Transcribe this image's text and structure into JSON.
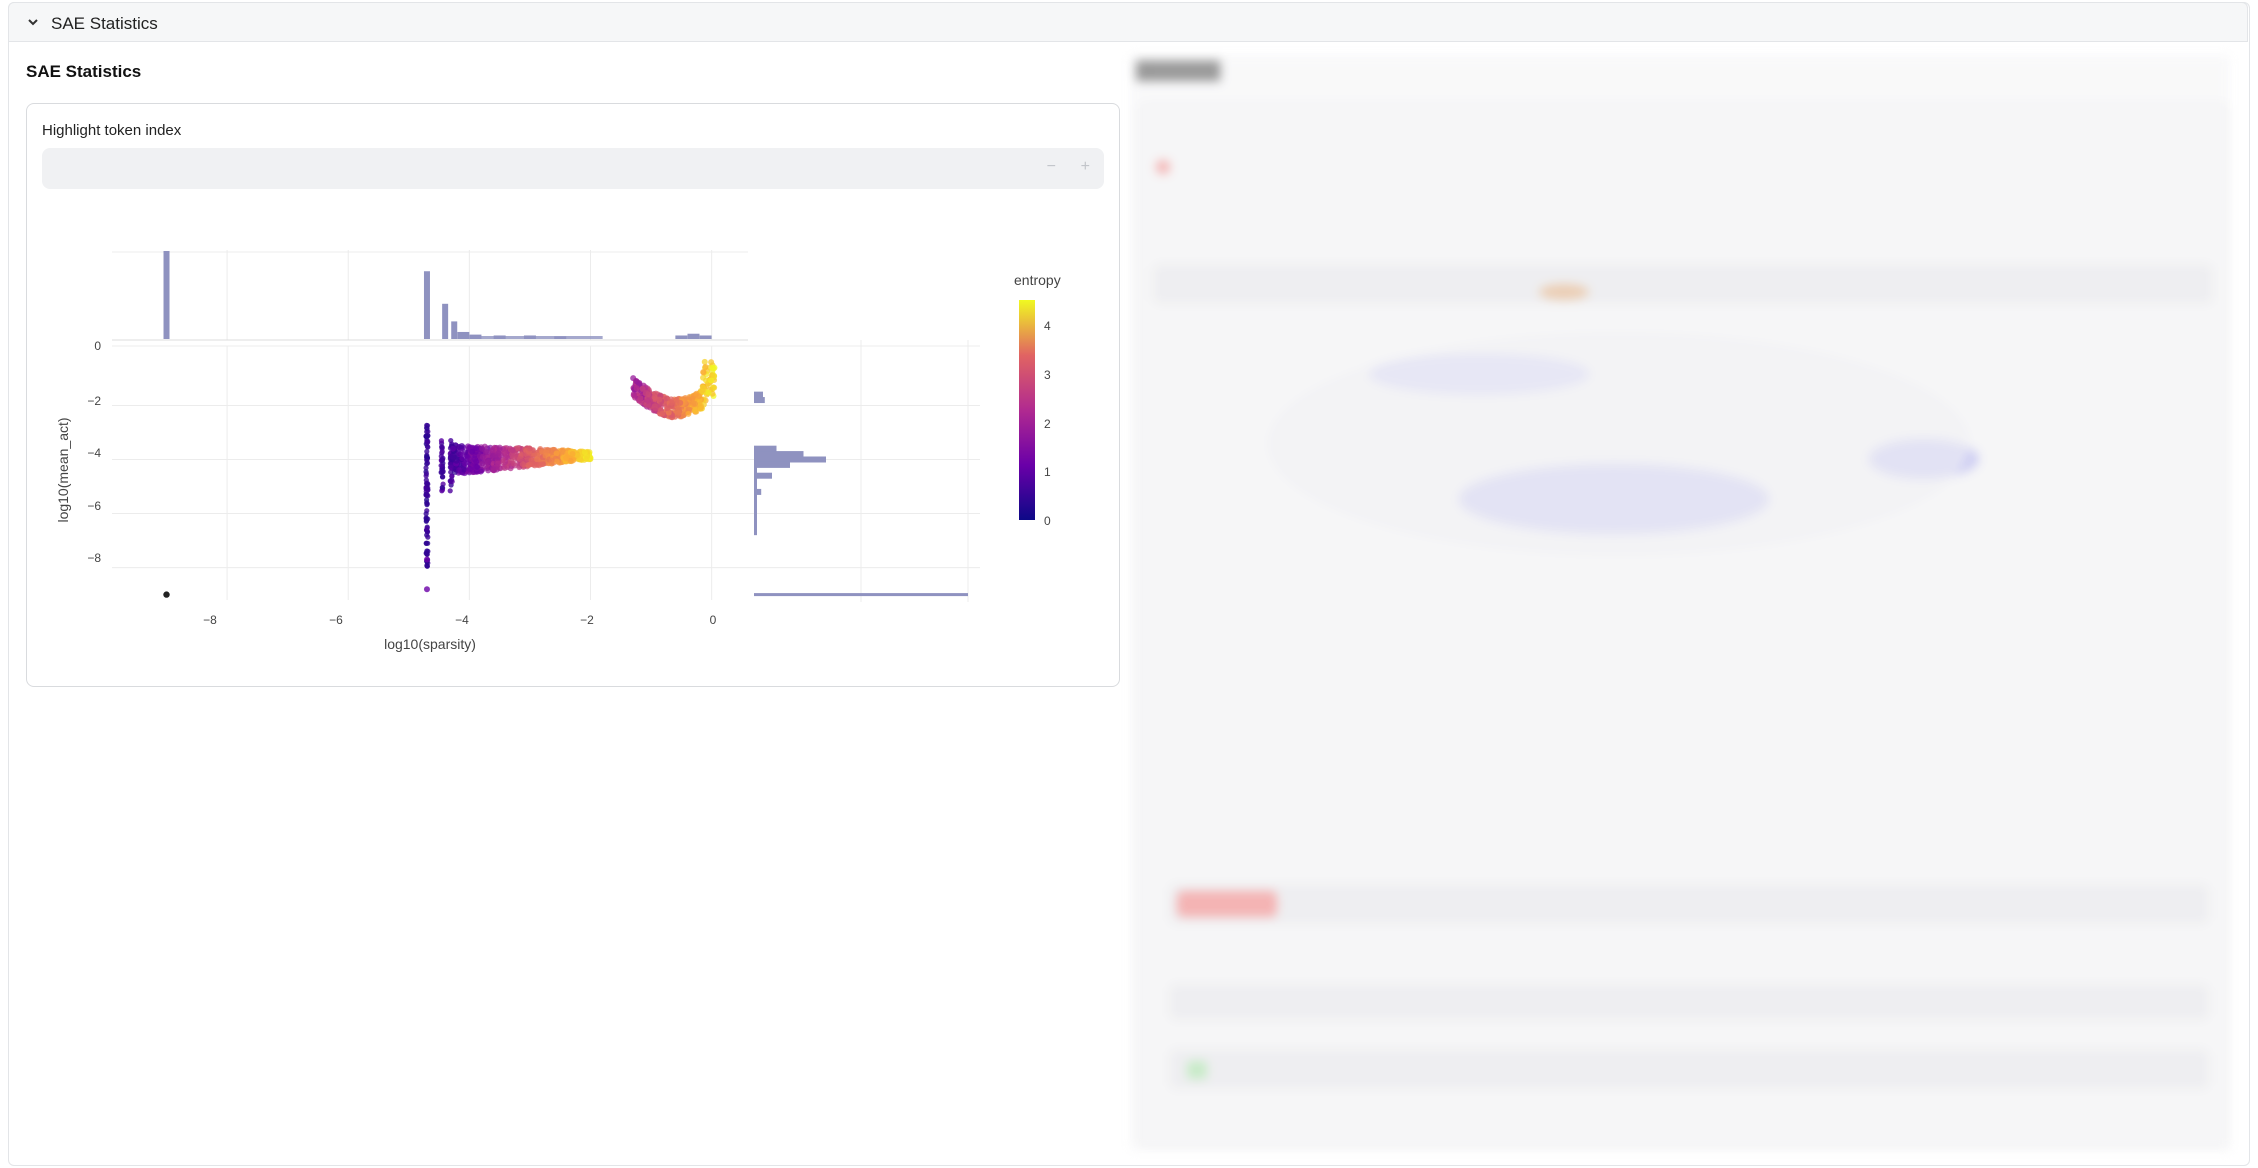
{
  "expander": {
    "title": "SAE Statistics"
  },
  "section": {
    "title": "SAE Statistics"
  },
  "highlight_input": {
    "label": "Highlight token index",
    "value": "",
    "minus": "−",
    "plus": "+"
  },
  "colors": {
    "marginal_hist": "#8f92c0",
    "viridis_low": "#0d0887",
    "viridis_high": "#f0f921"
  },
  "chart_data": {
    "type": "scatter",
    "xlabel": "log10(sparsity)",
    "ylabel": "log10(mean_act)",
    "x_ticks": [
      "−8",
      "−6",
      "−4",
      "−2",
      "0"
    ],
    "y_ticks": [
      "−2",
      "−4",
      "−6",
      "−8"
    ],
    "top_hist_tick": "0",
    "colorbar": {
      "title": "entropy",
      "ticks": [
        "4",
        "3",
        "2",
        "1",
        "0"
      ],
      "colorscale": "plasma"
    },
    "xlim": [
      -9.9,
      0.6
    ],
    "ylim": [
      -9.2,
      0.2
    ],
    "clusters": [
      {
        "name_hint": "outlier",
        "x": -9.0,
        "y": -9.0,
        "entropy": 0
      },
      {
        "name_hint": "vertical_stripe",
        "x": -4.7,
        "y_range": [
          -8.8,
          -2.6
        ],
        "entropy": 0.2
      },
      {
        "name_hint": "main_band",
        "x_range": [
          -4.4,
          -2.0
        ],
        "y_center": -4.0,
        "entropy_range": [
          0.5,
          4.5
        ]
      },
      {
        "name_hint": "top_right",
        "x_range": [
          -1.3,
          0.0
        ],
        "y_range": [
          -2.4,
          -0.5
        ],
        "entropy_range": [
          1.5,
          4.5
        ]
      }
    ],
    "top_histogram": [
      {
        "x": -9.0,
        "h": 1.0
      },
      {
        "x": -4.7,
        "h": 0.77
      },
      {
        "x": -4.4,
        "h": 0.4
      },
      {
        "x": -4.25,
        "h": 0.2
      },
      {
        "x": -4.1,
        "h": 0.08
      },
      {
        "x": -3.9,
        "h": 0.05
      },
      {
        "x": -3.5,
        "h": 0.04
      },
      {
        "x": -3.0,
        "h": 0.04
      },
      {
        "x": -2.5,
        "h": 0.03
      },
      {
        "x": -0.5,
        "h": 0.04
      },
      {
        "x": -0.3,
        "h": 0.06
      },
      {
        "x": -0.1,
        "h": 0.04
      }
    ],
    "right_histogram": [
      {
        "y": -1.8,
        "w": 0.12
      },
      {
        "y": -1.6,
        "w": 0.1
      },
      {
        "y": -3.6,
        "w": 0.25
      },
      {
        "y": -3.8,
        "w": 0.55
      },
      {
        "y": -4.0,
        "w": 0.8
      },
      {
        "y": -4.2,
        "w": 0.4
      },
      {
        "y": -4.6,
        "w": 0.2
      },
      {
        "y": -5.2,
        "w": 0.08
      },
      {
        "y": -9.0,
        "w": 2.5
      }
    ]
  }
}
